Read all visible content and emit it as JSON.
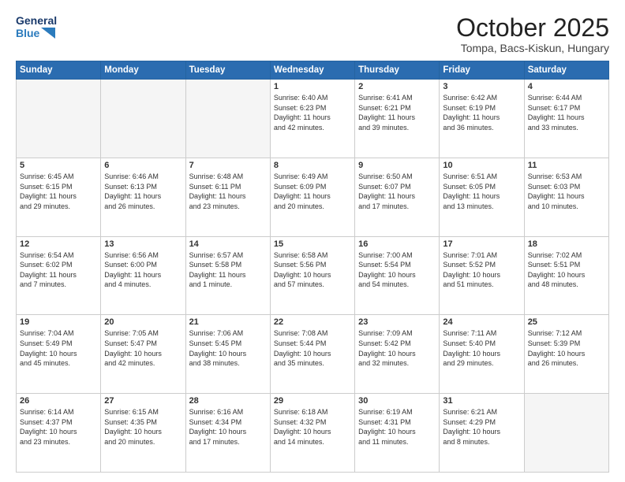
{
  "header": {
    "logo_line1": "General",
    "logo_line2": "Blue",
    "month": "October 2025",
    "location": "Tompa, Bacs-Kiskun, Hungary"
  },
  "weekdays": [
    "Sunday",
    "Monday",
    "Tuesday",
    "Wednesday",
    "Thursday",
    "Friday",
    "Saturday"
  ],
  "weeks": [
    [
      {
        "day": "",
        "info": ""
      },
      {
        "day": "",
        "info": ""
      },
      {
        "day": "",
        "info": ""
      },
      {
        "day": "1",
        "info": "Sunrise: 6:40 AM\nSunset: 6:23 PM\nDaylight: 11 hours\nand 42 minutes."
      },
      {
        "day": "2",
        "info": "Sunrise: 6:41 AM\nSunset: 6:21 PM\nDaylight: 11 hours\nand 39 minutes."
      },
      {
        "day": "3",
        "info": "Sunrise: 6:42 AM\nSunset: 6:19 PM\nDaylight: 11 hours\nand 36 minutes."
      },
      {
        "day": "4",
        "info": "Sunrise: 6:44 AM\nSunset: 6:17 PM\nDaylight: 11 hours\nand 33 minutes."
      }
    ],
    [
      {
        "day": "5",
        "info": "Sunrise: 6:45 AM\nSunset: 6:15 PM\nDaylight: 11 hours\nand 29 minutes."
      },
      {
        "day": "6",
        "info": "Sunrise: 6:46 AM\nSunset: 6:13 PM\nDaylight: 11 hours\nand 26 minutes."
      },
      {
        "day": "7",
        "info": "Sunrise: 6:48 AM\nSunset: 6:11 PM\nDaylight: 11 hours\nand 23 minutes."
      },
      {
        "day": "8",
        "info": "Sunrise: 6:49 AM\nSunset: 6:09 PM\nDaylight: 11 hours\nand 20 minutes."
      },
      {
        "day": "9",
        "info": "Sunrise: 6:50 AM\nSunset: 6:07 PM\nDaylight: 11 hours\nand 17 minutes."
      },
      {
        "day": "10",
        "info": "Sunrise: 6:51 AM\nSunset: 6:05 PM\nDaylight: 11 hours\nand 13 minutes."
      },
      {
        "day": "11",
        "info": "Sunrise: 6:53 AM\nSunset: 6:03 PM\nDaylight: 11 hours\nand 10 minutes."
      }
    ],
    [
      {
        "day": "12",
        "info": "Sunrise: 6:54 AM\nSunset: 6:02 PM\nDaylight: 11 hours\nand 7 minutes."
      },
      {
        "day": "13",
        "info": "Sunrise: 6:56 AM\nSunset: 6:00 PM\nDaylight: 11 hours\nand 4 minutes."
      },
      {
        "day": "14",
        "info": "Sunrise: 6:57 AM\nSunset: 5:58 PM\nDaylight: 11 hours\nand 1 minute."
      },
      {
        "day": "15",
        "info": "Sunrise: 6:58 AM\nSunset: 5:56 PM\nDaylight: 10 hours\nand 57 minutes."
      },
      {
        "day": "16",
        "info": "Sunrise: 7:00 AM\nSunset: 5:54 PM\nDaylight: 10 hours\nand 54 minutes."
      },
      {
        "day": "17",
        "info": "Sunrise: 7:01 AM\nSunset: 5:52 PM\nDaylight: 10 hours\nand 51 minutes."
      },
      {
        "day": "18",
        "info": "Sunrise: 7:02 AM\nSunset: 5:51 PM\nDaylight: 10 hours\nand 48 minutes."
      }
    ],
    [
      {
        "day": "19",
        "info": "Sunrise: 7:04 AM\nSunset: 5:49 PM\nDaylight: 10 hours\nand 45 minutes."
      },
      {
        "day": "20",
        "info": "Sunrise: 7:05 AM\nSunset: 5:47 PM\nDaylight: 10 hours\nand 42 minutes."
      },
      {
        "day": "21",
        "info": "Sunrise: 7:06 AM\nSunset: 5:45 PM\nDaylight: 10 hours\nand 38 minutes."
      },
      {
        "day": "22",
        "info": "Sunrise: 7:08 AM\nSunset: 5:44 PM\nDaylight: 10 hours\nand 35 minutes."
      },
      {
        "day": "23",
        "info": "Sunrise: 7:09 AM\nSunset: 5:42 PM\nDaylight: 10 hours\nand 32 minutes."
      },
      {
        "day": "24",
        "info": "Sunrise: 7:11 AM\nSunset: 5:40 PM\nDaylight: 10 hours\nand 29 minutes."
      },
      {
        "day": "25",
        "info": "Sunrise: 7:12 AM\nSunset: 5:39 PM\nDaylight: 10 hours\nand 26 minutes."
      }
    ],
    [
      {
        "day": "26",
        "info": "Sunrise: 6:14 AM\nSunset: 4:37 PM\nDaylight: 10 hours\nand 23 minutes."
      },
      {
        "day": "27",
        "info": "Sunrise: 6:15 AM\nSunset: 4:35 PM\nDaylight: 10 hours\nand 20 minutes."
      },
      {
        "day": "28",
        "info": "Sunrise: 6:16 AM\nSunset: 4:34 PM\nDaylight: 10 hours\nand 17 minutes."
      },
      {
        "day": "29",
        "info": "Sunrise: 6:18 AM\nSunset: 4:32 PM\nDaylight: 10 hours\nand 14 minutes."
      },
      {
        "day": "30",
        "info": "Sunrise: 6:19 AM\nSunset: 4:31 PM\nDaylight: 10 hours\nand 11 minutes."
      },
      {
        "day": "31",
        "info": "Sunrise: 6:21 AM\nSunset: 4:29 PM\nDaylight: 10 hours\nand 8 minutes."
      },
      {
        "day": "",
        "info": ""
      }
    ]
  ]
}
